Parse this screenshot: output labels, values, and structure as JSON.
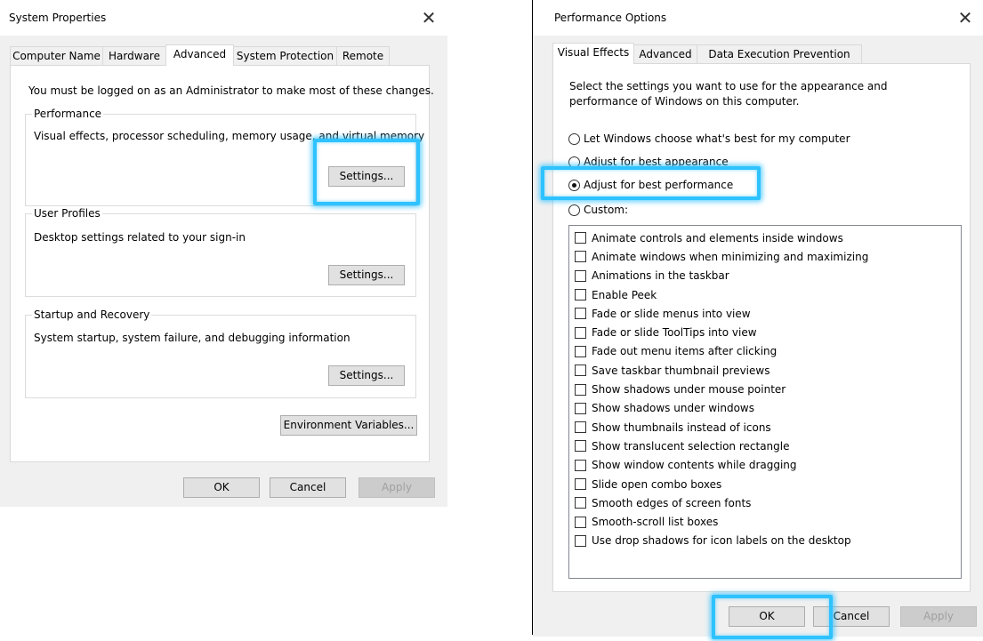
{
  "system_properties": {
    "title": "System Properties",
    "close_glyph": "✕",
    "tabs": [
      {
        "label": "Computer Name",
        "active": false
      },
      {
        "label": "Hardware",
        "active": false
      },
      {
        "label": "Advanced",
        "active": true
      },
      {
        "label": "System Protection",
        "active": false
      },
      {
        "label": "Remote",
        "active": false
      }
    ],
    "admin_notice": "You must be logged on as an Administrator to make most of these changes.",
    "performance": {
      "label": "Performance",
      "description": "Visual effects, processor scheduling, memory usage, and virtual memory",
      "button": "Settings..."
    },
    "user_profiles": {
      "label": "User Profiles",
      "description": "Desktop settings related to your sign-in",
      "button": "Settings..."
    },
    "startup_recovery": {
      "label": "Startup and Recovery",
      "description": "System startup, system failure, and debugging information",
      "button": "Settings..."
    },
    "environment_button": "Environment Variables...",
    "ok": "OK",
    "cancel": "Cancel",
    "apply": "Apply"
  },
  "performance_options": {
    "title": "Performance Options",
    "close_glyph": "✕",
    "tabs": [
      {
        "label": "Visual Effects",
        "active": true
      },
      {
        "label": "Advanced",
        "active": false
      },
      {
        "label": "Data Execution Prevention",
        "active": false
      }
    ],
    "intro_line1": "Select the settings you want to use for the appearance and",
    "intro_line2": "performance of Windows on this computer.",
    "radio_options": [
      {
        "label": "Let Windows choose what's best for my computer",
        "checked": false
      },
      {
        "label": "Adjust for best appearance",
        "checked": false
      },
      {
        "label": "Adjust for best performance",
        "checked": true
      },
      {
        "label": "Custom:",
        "checked": false
      }
    ],
    "effects": [
      {
        "label": "Animate controls and elements inside windows",
        "checked": false
      },
      {
        "label": "Animate windows when minimizing and maximizing",
        "checked": false
      },
      {
        "label": "Animations in the taskbar",
        "checked": false
      },
      {
        "label": "Enable Peek",
        "checked": false
      },
      {
        "label": "Fade or slide menus into view",
        "checked": false
      },
      {
        "label": "Fade or slide ToolTips into view",
        "checked": false
      },
      {
        "label": "Fade out menu items after clicking",
        "checked": false
      },
      {
        "label": "Save taskbar thumbnail previews",
        "checked": false
      },
      {
        "label": "Show shadows under mouse pointer",
        "checked": false
      },
      {
        "label": "Show shadows under windows",
        "checked": false
      },
      {
        "label": "Show thumbnails instead of icons",
        "checked": false
      },
      {
        "label": "Show translucent selection rectangle",
        "checked": false
      },
      {
        "label": "Show window contents while dragging",
        "checked": false
      },
      {
        "label": "Slide open combo boxes",
        "checked": false
      },
      {
        "label": "Smooth edges of screen fonts",
        "checked": false
      },
      {
        "label": "Smooth-scroll list boxes",
        "checked": false
      },
      {
        "label": "Use drop shadows for icon labels on the desktop",
        "checked": false
      }
    ],
    "ok": "OK",
    "cancel": "Cancel",
    "apply": "Apply"
  },
  "highlight_color": "#2ec2ff"
}
